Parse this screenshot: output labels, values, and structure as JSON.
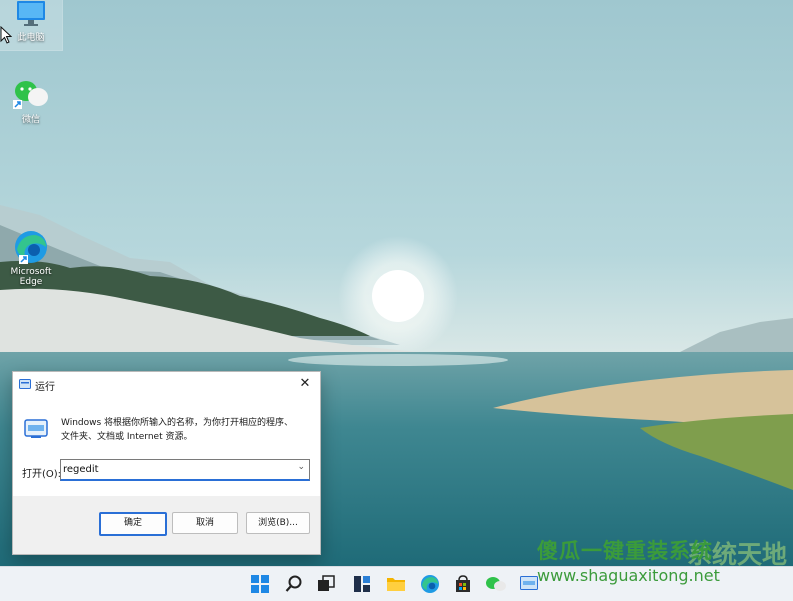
{
  "desktop": {
    "icons": [
      {
        "label": "此电脑",
        "icon": "pc-monitor-icon"
      },
      {
        "label": "微信",
        "icon": "wechat-icon"
      },
      {
        "label": "Microsoft Edge",
        "icon": "edge-icon"
      }
    ]
  },
  "run_dialog": {
    "title": "运行",
    "description_line1": "Windows 将根据你所输入的名称，为你打开相应的程序、",
    "description_line2": "文件夹、文档或 Internet 资源。",
    "open_label": "打开(O):",
    "input_value": "regedit",
    "buttons": {
      "ok": "确定",
      "cancel": "取消",
      "browse": "浏览(B)..."
    }
  },
  "taskbar": {
    "icons": [
      "start-icon",
      "search-icon",
      "task-view-icon",
      "widgets-icon",
      "file-explorer-icon",
      "edge-icon",
      "store-icon",
      "wechat-icon",
      "run-icon"
    ]
  },
  "watermark": {
    "title": "傻瓜一键重装系统",
    "background_text": "系统天地",
    "url": "www.shaguaxitong.net"
  },
  "colors": {
    "accent": "#2a6fd6",
    "taskbar": "#eef2f6",
    "watermark_green": "#3b9b3b"
  }
}
